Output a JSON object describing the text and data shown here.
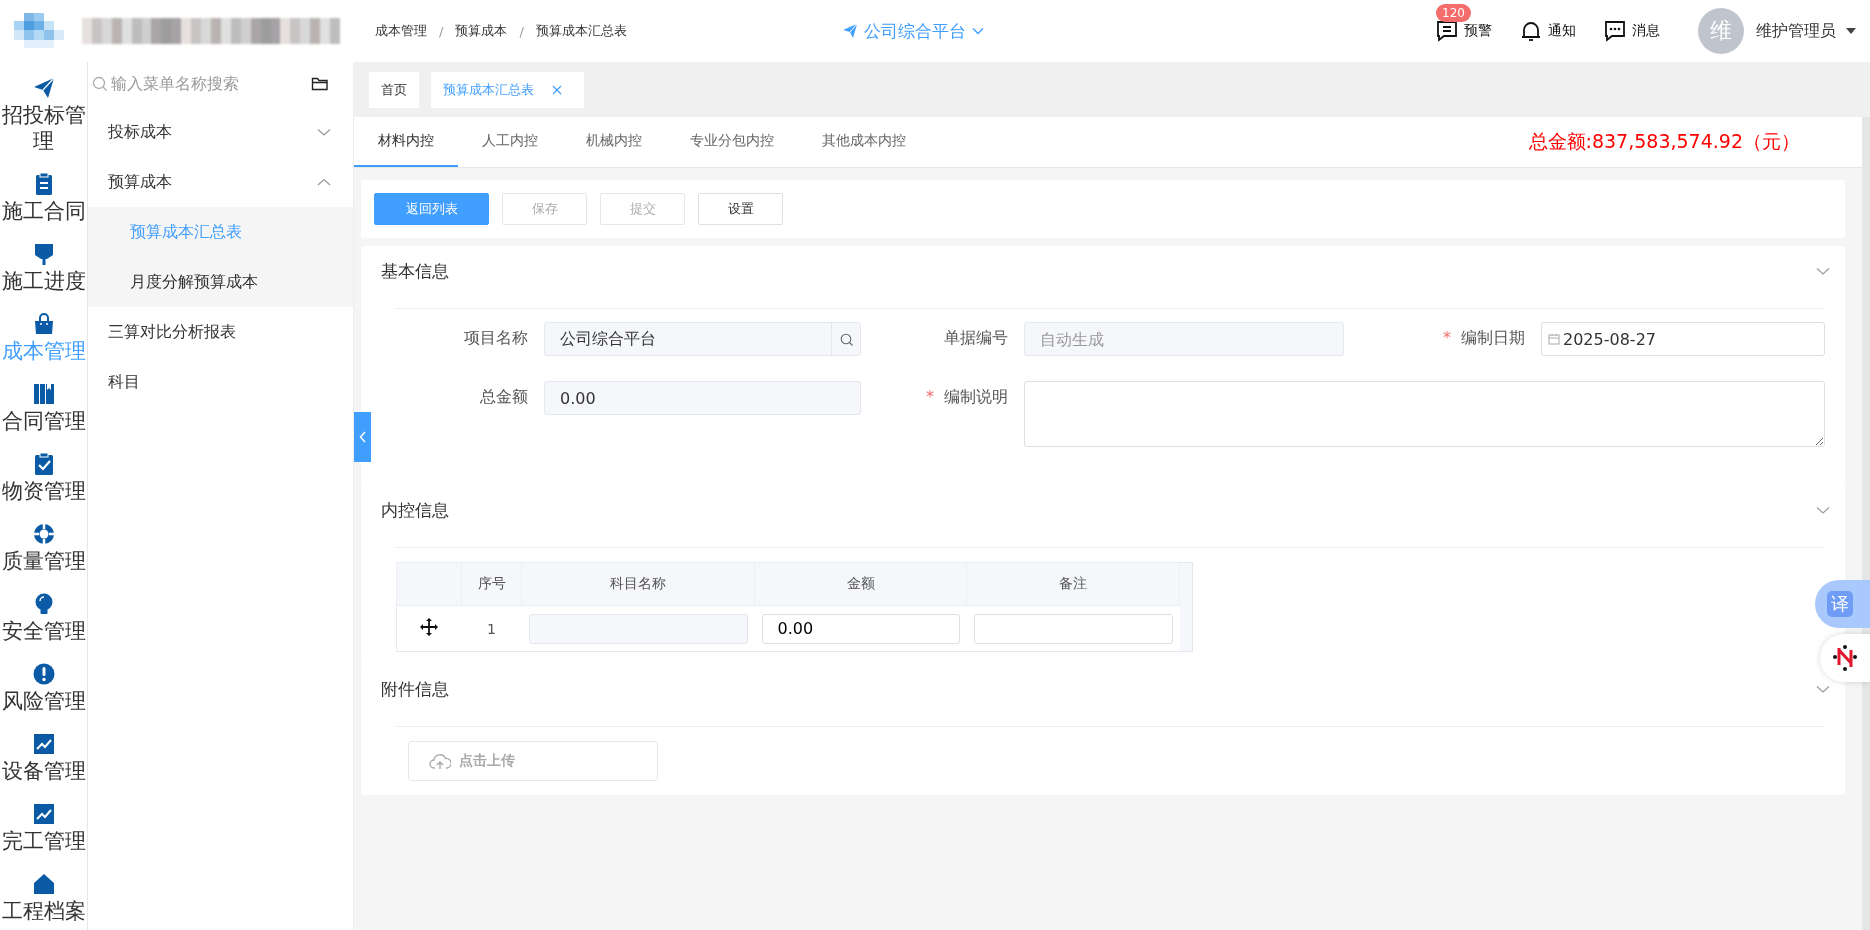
{
  "header": {
    "breadcrumb": [
      "成本管理",
      "预算成本",
      "预算成本汇总表"
    ],
    "breadcrumb_separator": "/",
    "platform": "公司综合平台",
    "actions": [
      {
        "label": "预警",
        "badge": "120"
      },
      {
        "label": "通知"
      },
      {
        "label": "消息"
      }
    ],
    "user": {
      "avatar": "维",
      "name": "维护管理员"
    }
  },
  "rail": [
    {
      "label": "招投标管理",
      "selected": false
    },
    {
      "label": "施工合同",
      "selected": false
    },
    {
      "label": "施工进度",
      "selected": false
    },
    {
      "label": "成本管理",
      "selected": true
    },
    {
      "label": "合同管理",
      "selected": false
    },
    {
      "label": "物资管理",
      "selected": false
    },
    {
      "label": "质量管理",
      "selected": false
    },
    {
      "label": "安全管理",
      "selected": false
    },
    {
      "label": "风险管理",
      "selected": false
    },
    {
      "label": "设备管理",
      "selected": false
    },
    {
      "label": "完工管理",
      "selected": false
    },
    {
      "label": "工程档案",
      "selected": false
    }
  ],
  "menu": {
    "search": {
      "placeholder": "输入菜单名称搜索"
    },
    "items": [
      {
        "label": "投标成本",
        "selected": false,
        "expanded": false
      },
      {
        "label": "预算成本",
        "selected": false,
        "expanded": true,
        "children": [
          {
            "label": "预算成本汇总表",
            "selected": true
          },
          {
            "label": "月度分解预算成本",
            "selected": false
          }
        ]
      },
      {
        "label": "三算对比分析报表",
        "selected": false
      },
      {
        "label": "科目",
        "selected": false
      }
    ]
  },
  "page_tabs": [
    {
      "label": "首页",
      "selected": false,
      "closable": false
    },
    {
      "label": "预算成本汇总表",
      "selected": true,
      "closable": true
    }
  ],
  "sub_tabs": [
    {
      "label": "材料内控",
      "selected": true
    },
    {
      "label": "人工内控",
      "selected": false
    },
    {
      "label": "机械内控",
      "selected": false
    },
    {
      "label": "专业分包内控",
      "selected": false
    },
    {
      "label": "其他成本内控",
      "selected": false
    }
  ],
  "total_amount": "总金额:837,583,574.92（元）",
  "toolbar": [
    {
      "label": "返回列表",
      "kind": "primary",
      "disabled": false
    },
    {
      "label": "保存",
      "kind": "default",
      "disabled": true
    },
    {
      "label": "提交",
      "kind": "default",
      "disabled": true
    },
    {
      "label": "设置",
      "kind": "default",
      "disabled": false
    }
  ],
  "sections": [
    {
      "title": "基本信息",
      "kind": "form",
      "expanded": true,
      "fields": [
        {
          "label": "项目名称",
          "kind": "lookup",
          "value": "公司综合平台",
          "disabled": true
        },
        {
          "label": "单据编号",
          "kind": "text",
          "placeholder": "自动生成",
          "disabled": true
        },
        {
          "label": "编制日期",
          "required_mark": "*",
          "kind": "date",
          "value": "2025-08-27",
          "disabled": false
        },
        {
          "label": "总金额",
          "kind": "text",
          "value": "0.00",
          "disabled": true
        },
        {
          "label": "编制说明",
          "required_mark": "*",
          "kind": "textarea",
          "disabled": false
        }
      ]
    },
    {
      "title": "内控信息",
      "kind": "table",
      "expanded": true,
      "columns": [
        "序号",
        "科目名称",
        "金额",
        "备注"
      ],
      "rows": [
        {
          "number": "1",
          "amount": "0.00"
        }
      ]
    },
    {
      "title": "附件信息",
      "kind": "upload",
      "expanded": true,
      "upload_label": "点击上传"
    }
  ],
  "floating": {
    "translate_label": "译"
  }
}
